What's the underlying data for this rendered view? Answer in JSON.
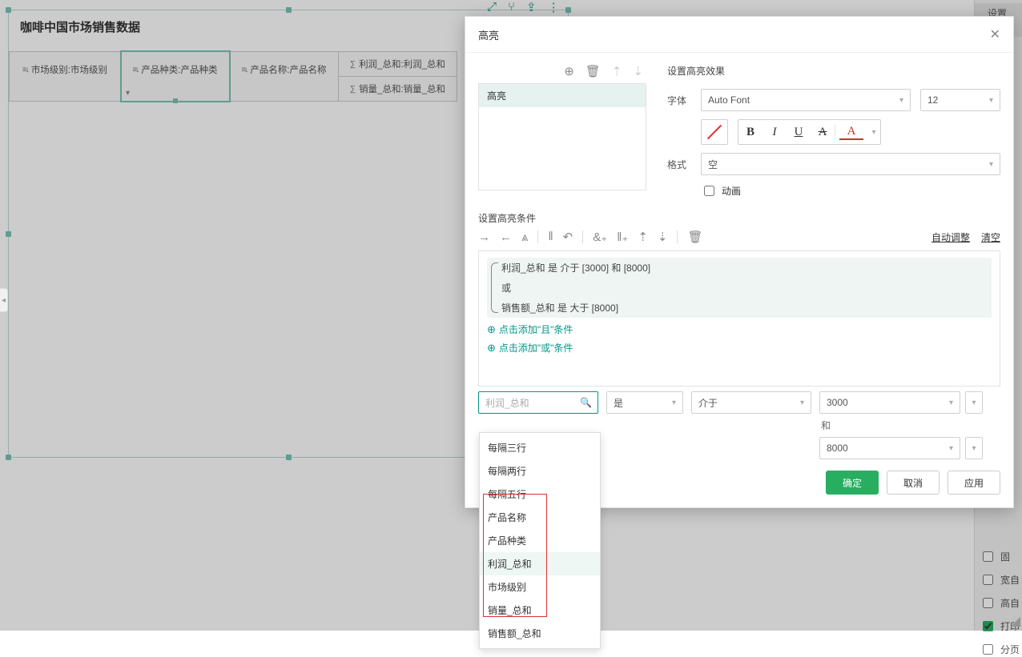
{
  "report": {
    "title": "咖啡中国市场销售数据",
    "columns": [
      {
        "label": "市场级别:市场级别",
        "kind": "dim"
      },
      {
        "label": "产品种类:产品种类",
        "kind": "dim",
        "selected": true
      },
      {
        "label": "产品名称:产品名称",
        "kind": "dim"
      }
    ],
    "measures": [
      {
        "label": "利润_总和:利润_总和"
      },
      {
        "label": "销量_总和:销量_总和"
      }
    ]
  },
  "strip": {
    "expand": "⤢",
    "filter": "⑂",
    "export": "⇪",
    "more": "⋮"
  },
  "rightPanel": {
    "tab": "设置 (自由",
    "checks": [
      {
        "label": "固",
        "checked": false
      },
      {
        "label": "宽自",
        "checked": false
      },
      {
        "label": "高自",
        "checked": false
      },
      {
        "label": "打印",
        "checked": true
      },
      {
        "label": "分页",
        "checked": false
      }
    ]
  },
  "dialog": {
    "title": "高亮",
    "ruleListItem": "高亮",
    "effect": {
      "section": "设置高亮效果",
      "fontLabel": "字体",
      "fontValue": "Auto Font",
      "sizeValue": "12",
      "formatLabel": "格式",
      "formatValue": "空",
      "animLabel": "动画",
      "style": {
        "bold": "B",
        "italic": "I",
        "underline": "U",
        "strike": "A",
        "color": "A"
      }
    },
    "cond": {
      "section": "设置高亮条件",
      "autoAdjust": "自动调整",
      "clear": "清空",
      "group": [
        "利润_总和 是 介于 [3000] 和 [8000]",
        "或",
        "销售额_总和 是 大于 [8000]"
      ],
      "addAnd": "点击添加\"且\"条件",
      "addOr": "点击添加\"或\"条件",
      "fieldPlaceholder": "利润_总和",
      "op": "是",
      "cmp": "介于",
      "val1": "3000",
      "andWord": "和",
      "val2": "8000"
    },
    "dropdown": [
      "每隔三行",
      "每隔两行",
      "每隔五行",
      "产品名称",
      "产品种类",
      "利润_总和",
      "市场级别",
      "销量_总和",
      "销售额_总和"
    ],
    "buttons": {
      "ok": "确定",
      "cancel": "取消",
      "apply": "应用"
    }
  }
}
